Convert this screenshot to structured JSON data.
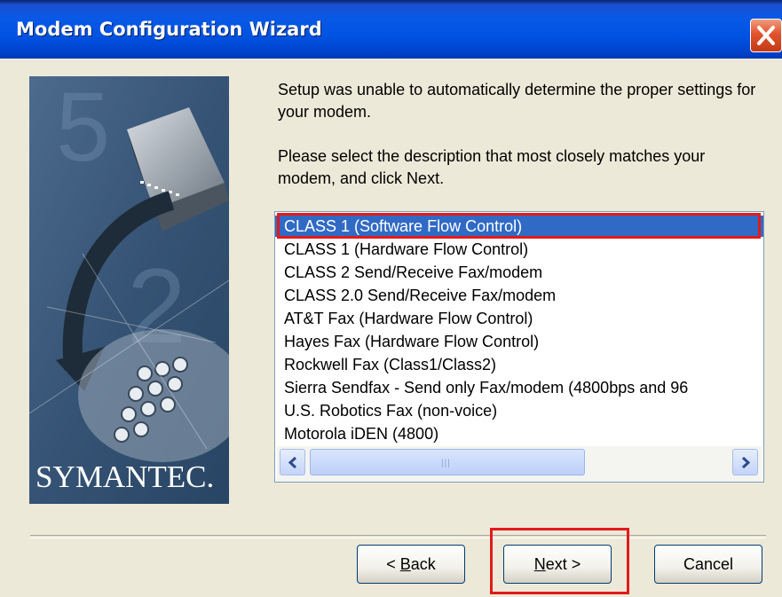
{
  "window": {
    "title": "Modem Configuration Wizard",
    "close_icon": "close-icon"
  },
  "sidebar": {
    "brand": "SYMANTEC."
  },
  "content": {
    "message1": "Setup was unable to automatically determine the proper settings for your modem.",
    "message2": "Please select the description that most closely matches your modem, and click Next."
  },
  "modem_list": {
    "selected_index": 0,
    "items": [
      "CLASS 1 (Software Flow Control)",
      "CLASS 1 (Hardware Flow Control)",
      "CLASS 2 Send/Receive Fax/modem",
      "CLASS 2.0 Send/Receive Fax/modem",
      "AT&T Fax  (Hardware Flow Control)",
      "Hayes Fax  (Hardware Flow Control)",
      "Rockwell Fax (Class1/Class2)",
      "Sierra Sendfax - Send only Fax/modem (4800bps and 96",
      "U.S. Robotics Fax (non-voice)",
      "Motorola iDEN (4800)"
    ]
  },
  "buttons": {
    "back_mnemonic": "B",
    "back_rest": "ack",
    "back_prefix": "< ",
    "next_mnemonic": "N",
    "next_rest": "ext >",
    "cancel": "Cancel"
  },
  "colors": {
    "title_bar": "#0054e3",
    "selection": "#316ac5",
    "highlight_box": "#e21b1b",
    "dialog_bg": "#ece9d8"
  }
}
